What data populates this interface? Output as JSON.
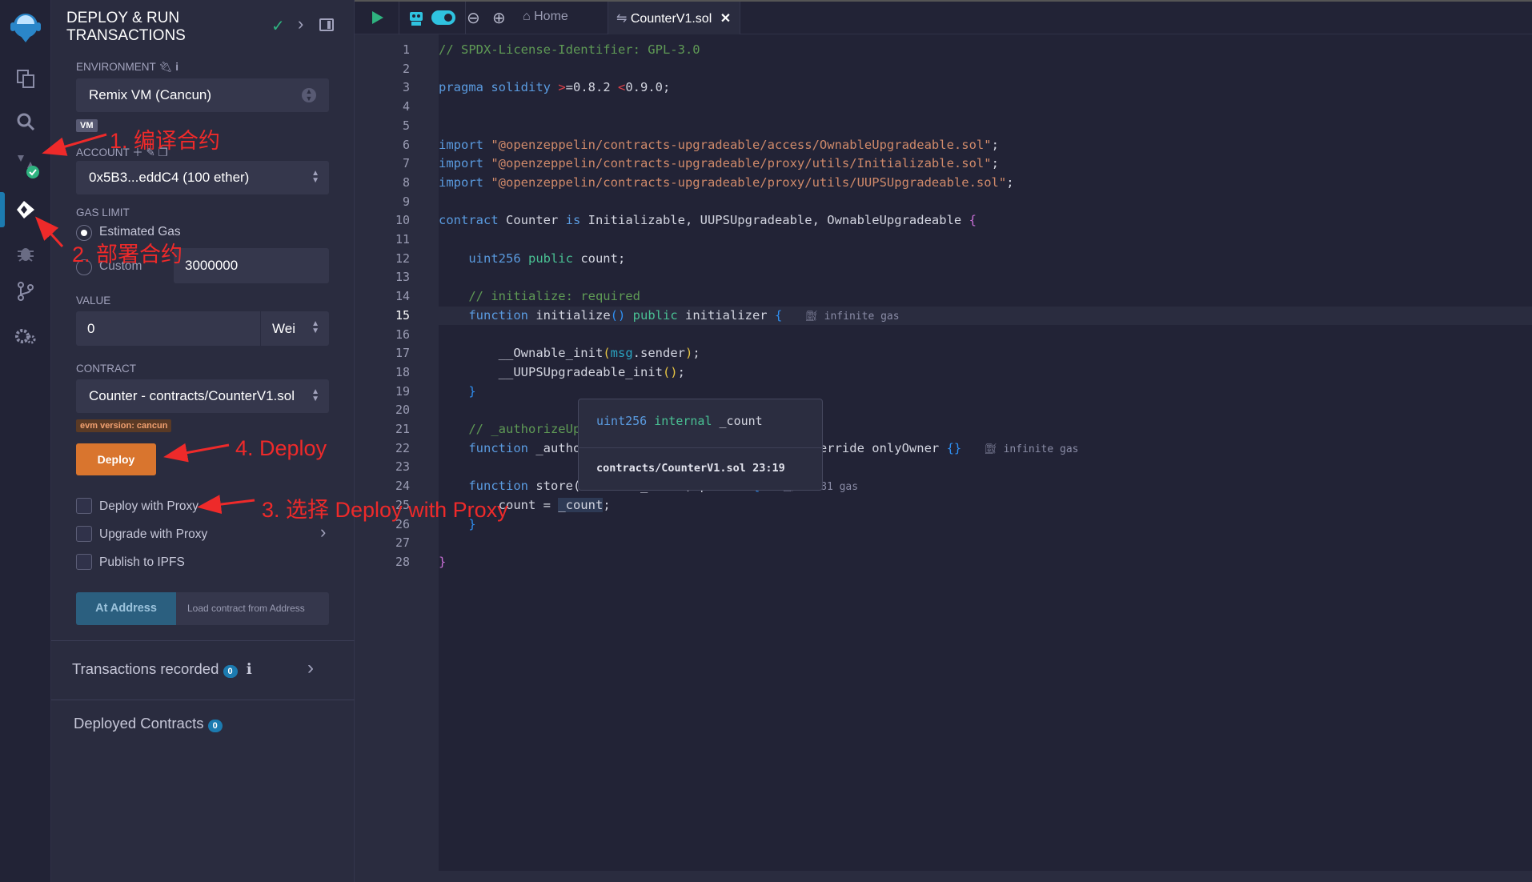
{
  "iconbar": {
    "items": [
      "remix-logo",
      "file-explorer",
      "search",
      "solidity-compiler",
      "deploy-run",
      "debugger",
      "git",
      "plugin-manager"
    ]
  },
  "panel": {
    "title": "DEPLOY & RUN TRANSACTIONS",
    "environment": {
      "label": "ENVIRONMENT",
      "value": "Remix VM (Cancun)",
      "badge": "VM"
    },
    "account": {
      "label": "ACCOUNT",
      "value": "0x5B3...eddC4 (100 ether)"
    },
    "gas_limit": {
      "label": "GAS LIMIT",
      "options": [
        "Estimated Gas",
        "Custom"
      ],
      "selected": "Estimated Gas",
      "custom_value": "3000000"
    },
    "value": {
      "label": "VALUE",
      "amount": "0",
      "unit": "Wei"
    },
    "contract": {
      "label": "CONTRACT",
      "value": "Counter - contracts/CounterV1.sol",
      "evm_badge": "evm version: cancun"
    },
    "deploy_label": "Deploy",
    "checkboxes": [
      "Deploy with Proxy",
      "Upgrade with Proxy",
      "Publish to IPFS"
    ],
    "at_address_label": "At Address",
    "load_placeholder": "Load contract from Address",
    "transactions_recorded": {
      "label": "Transactions recorded",
      "count": "0",
      "info": "i"
    },
    "deployed_contracts": {
      "label": "Deployed Contracts",
      "count": "0"
    }
  },
  "annotations": [
    "1. 编译合约",
    "2. 部署合约",
    "3. 选择 Deploy with Proxy",
    "4. Deploy"
  ],
  "tabs": {
    "home": "Home",
    "file": "CounterV1.sol"
  },
  "editor": {
    "current_line": 15,
    "lines": [
      [
        [
          "// SPDX-License-Identifier: GPL-3.0",
          "c"
        ]
      ],
      [],
      [
        [
          "pragma solidity ",
          "k"
        ],
        [
          ">",
          "op"
        ],
        [
          "=0.8.2 ",
          ""
        ],
        [
          "<",
          "op"
        ],
        [
          "0.9.0;",
          ""
        ]
      ],
      [],
      [],
      [
        [
          "import ",
          "k"
        ],
        [
          "\"@openzeppelin/contracts-upgradeable/access/OwnableUpgradeable.sol\"",
          "s"
        ],
        [
          ";",
          ""
        ]
      ],
      [
        [
          "import ",
          "k"
        ],
        [
          "\"@openzeppelin/contracts-upgradeable/proxy/utils/Initializable.sol\"",
          "s"
        ],
        [
          ";",
          ""
        ]
      ],
      [
        [
          "import ",
          "k"
        ],
        [
          "\"@openzeppelin/contracts-upgradeable/proxy/utils/UUPSUpgradeable.sol\"",
          "s"
        ],
        [
          ";",
          ""
        ]
      ],
      [],
      [
        [
          "contract ",
          "k"
        ],
        [
          "Counter ",
          ""
        ],
        [
          "is ",
          "k"
        ],
        [
          "Initializable, UUPSUpgradeable, OwnableUpgradeable ",
          ""
        ],
        [
          "{",
          "p"
        ]
      ],
      [],
      [
        [
          "    uint256 ",
          "k"
        ],
        [
          "public ",
          "g"
        ],
        [
          "count;",
          ""
        ]
      ],
      [],
      [
        [
          "    // initialize: required",
          "c"
        ]
      ],
      [
        [
          "    function ",
          "k"
        ],
        [
          "initialize",
          ""
        ],
        [
          "()",
          "b"
        ],
        [
          " public ",
          "g"
        ],
        [
          "initializer ",
          ""
        ],
        [
          "{",
          "b"
        ]
      ],
      [],
      [
        [
          "        __Ownable_init",
          ""
        ],
        [
          "(",
          "y"
        ],
        [
          "msg",
          "m"
        ],
        [
          ".sender",
          ""
        ],
        [
          ")",
          "y"
        ],
        [
          ";",
          ""
        ]
      ],
      [
        [
          "        __UUPSUpgradeable_init",
          ""
        ],
        [
          "()",
          "y"
        ],
        [
          ";",
          ""
        ]
      ],
      [
        [
          "    }",
          "b"
        ]
      ],
      [],
      [
        [
          "    // _authorizeUpgrade: required",
          "c"
        ]
      ],
      [
        [
          "    function ",
          "k"
        ],
        [
          "_authorizeUpgrade(address) internal override onlyOwner ",
          ""
        ],
        [
          "{}",
          "b"
        ]
      ],
      [],
      [
        [
          "    function ",
          "k"
        ],
        [
          "store(uint256 _count) public ",
          ""
        ],
        [
          "{",
          "b"
        ]
      ],
      [
        [
          "        count = _count;",
          ""
        ]
      ],
      [
        [
          "    }",
          "b"
        ]
      ],
      [],
      [
        [
          "}",
          "p"
        ]
      ]
    ],
    "gas_hints": [
      {
        "line": 15,
        "text": "infinite gas"
      },
      {
        "line": 22,
        "text": "infinite gas"
      },
      {
        "line": 24,
        "text": "22581 gas"
      }
    ]
  },
  "tooltip": {
    "type": "uint256",
    "visibility": "internal",
    "name": "_count",
    "location": "contracts/CounterV1.sol 23:19"
  }
}
